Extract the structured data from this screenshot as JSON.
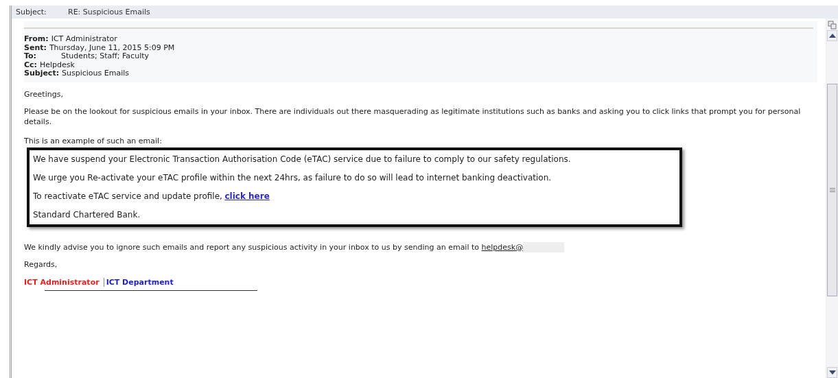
{
  "subject_bar": {
    "label": "Subject:",
    "value": "RE: Suspicious Emails"
  },
  "header": [
    {
      "label": "From:",
      "value": "ICT Administrator"
    },
    {
      "label": "Sent:",
      "value": "Thursday, June 11, 2015 5:09 PM"
    },
    {
      "label": "To:",
      "value": "Students; Staff; Faculty"
    },
    {
      "label": "Cc:",
      "value": "Helpdesk"
    },
    {
      "label": "Subject:",
      "value": "Suspicious Emails"
    }
  ],
  "greeting": "Greetings,",
  "intro": "Please be on the lookout for suspicious emails in your inbox. There are individuals out there masquerading as legitimate institutions such as banks and asking you to click links that prompt you for personal details.",
  "example_label": "This is an example of such an email:",
  "example": [
    {
      "text": "We have suspend your Electronic Transaction Authorisation Code (eTAC) service due to failure to comply to our safety regulations."
    },
    {
      "text": "We urge you Re-activate your eTAC profile within the next 24hrs, as failure to do so will lead to internet banking deactivation."
    },
    {
      "text": "To reactivate eTAC service and update profile,",
      "link": "click here"
    },
    {
      "text": "Standard Chartered Bank."
    }
  ],
  "advice": "We kindly advise you to ignore such emails and report any suspicious activity in your inbox to us by sending an email to",
  "advice_link": "helpdesk@",
  "closing": "Regards,",
  "signature": [
    {
      "text": "ICT Administrator",
      "color": "#ee1c1c"
    },
    {
      "text": "ICT Department",
      "color": "#2020d0"
    }
  ]
}
